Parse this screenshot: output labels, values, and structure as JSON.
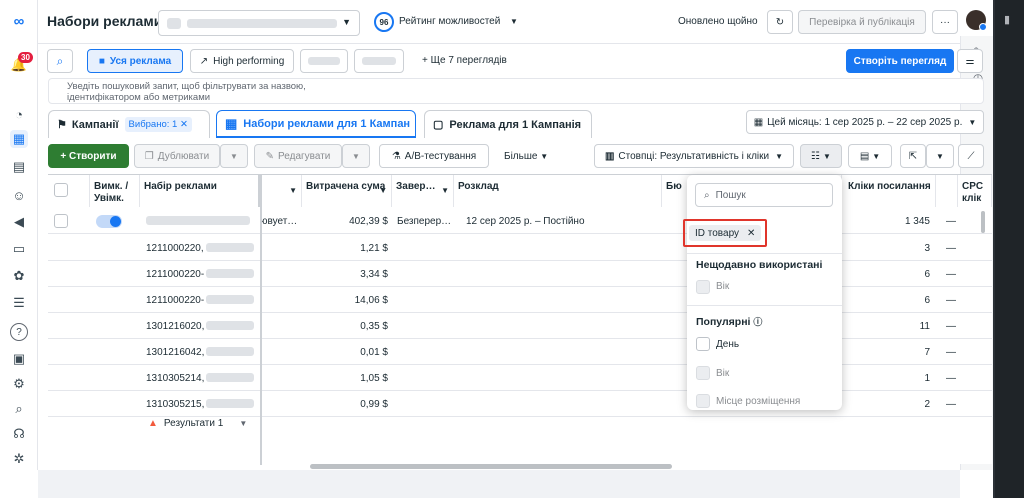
{
  "nav": {
    "notification_count": "30"
  },
  "header": {
    "title": "Набори реклами",
    "score": "96",
    "score_label": "Рейтинг можливостей",
    "updated": "Оновлено щойно",
    "review_publish": "Перевірка й публікація",
    "more": "···"
  },
  "views": {
    "all_ads": "Уся реклама",
    "high_performing": "High performing",
    "more_views": "Ще 7 переглядів",
    "create_view": "Створіть перегляд"
  },
  "search": {
    "placeholder_line1": "Уведіть пошуковий запит, щоб фільтрувати за назвою,",
    "placeholder_line2": "ідентифікатором або метриками"
  },
  "tabs": {
    "campaigns": "Кампанії",
    "selected": "Вибрано: 1",
    "adsets": "Набори реклами для 1 Кампан",
    "ads": "Реклама для 1 Кампанія",
    "date_range": "Цей місяць: 1 сер 2025 р. – 22 сер 2025 р."
  },
  "toolbar": {
    "create": "+ Створити",
    "duplicate": "Дублювати",
    "edit": "Редагувати",
    "ab_test": "А/В-тестування",
    "more": "Більше",
    "columns": "Стовпці: Результативність і кліки"
  },
  "table": {
    "headers": {
      "toggle": "Вимк. / Увімк.",
      "adset": "Набір реклами",
      "spent": "Витрачена сума",
      "end": "Завер…",
      "schedule": "Розклад",
      "budget": "Бю",
      "clicks": "Кліки посилання",
      "cpc": "CPC клік"
    },
    "first_row": {
      "spent": "402,39 $",
      "end": "Безперер…",
      "schedule": "12 сер 2025 р. – Постійно",
      "clicks": "1 345",
      "cpc": "—",
      "partial": "ювует…"
    },
    "rows": [
      {
        "name": "1211000220,",
        "spent": "1,21 $",
        "clicks": "3",
        "cpc": "—"
      },
      {
        "name": "1211000220-",
        "spent": "3,34 $",
        "clicks": "6",
        "cpc": "—"
      },
      {
        "name": "1211000220-",
        "spent": "14,06 $",
        "clicks": "6",
        "cpc": "—"
      },
      {
        "name": "1301216020,",
        "spent": "0,35 $",
        "clicks": "11",
        "cpc": "—"
      },
      {
        "name": "1301216042,",
        "spent": "0,01 $",
        "clicks": "7",
        "cpc": "—"
      },
      {
        "name": "1310305214,",
        "spent": "1,05 $",
        "clicks": "1",
        "cpc": "—"
      },
      {
        "name": "1310305215,",
        "spent": "0,99 $",
        "clicks": "2",
        "cpc": "—"
      }
    ],
    "results": "Результати 1"
  },
  "popup": {
    "search_placeholder": "Пошук",
    "chip": "ID товару",
    "recent_title": "Нещодавно використані",
    "recent_items": [
      "Вік"
    ],
    "popular_title": "Популярні",
    "popular_items": [
      "День",
      "Вік",
      "Місце розміщення"
    ]
  },
  "colors": {
    "accent": "#1877f2",
    "create_green": "#2e7d32",
    "highlight_red": "#e0352b"
  }
}
